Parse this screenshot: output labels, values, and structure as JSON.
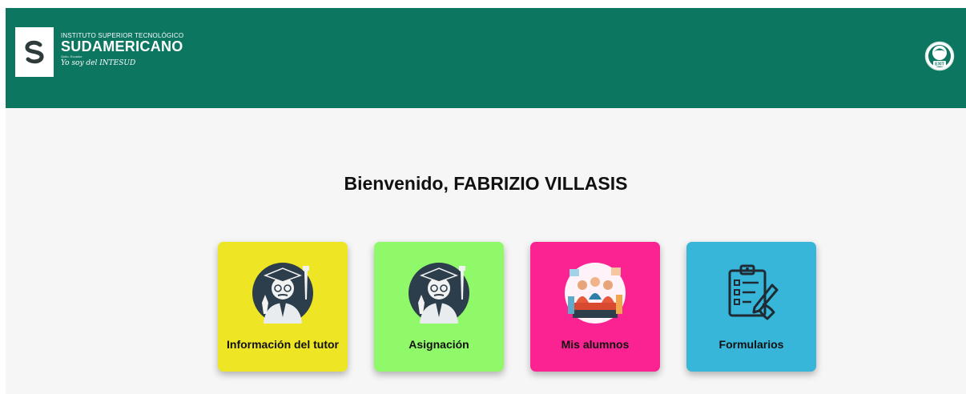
{
  "header": {
    "logo_line1": "INSTITUTO SUPERIOR TECNOLÓGICO",
    "logo_line2": "SUDAMERICANO",
    "logo_line3": "Quito, Ecuador",
    "logo_line4": "Yo soy del INTESUD",
    "exit_label": "EXIT",
    "bg_color": "#0c7661"
  },
  "main": {
    "welcome": "Bienvenido, FABRIZIO VILLASIS",
    "cards": [
      {
        "label": "Información del tutor",
        "color": "#eee625",
        "icon": "tutor-icon"
      },
      {
        "label": "Asignación",
        "color": "#90f96a",
        "icon": "tutor-icon"
      },
      {
        "label": "Mis alumnos",
        "color": "#fb2391",
        "icon": "students-icon"
      },
      {
        "label": "Formularios",
        "color": "#37b6d9",
        "icon": "clipboard-form-icon"
      }
    ]
  }
}
